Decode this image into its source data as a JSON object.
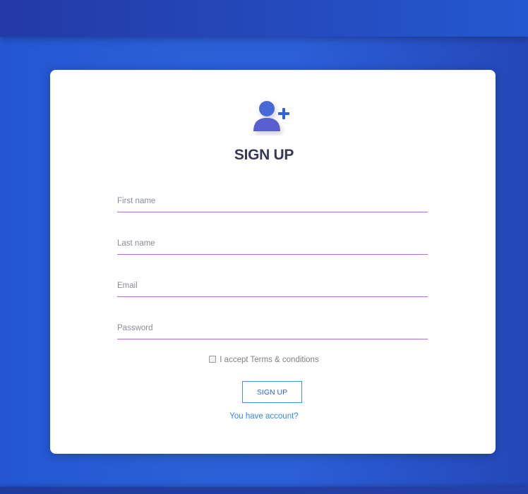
{
  "form": {
    "title": "SIGN UP",
    "icon": "add-user-icon",
    "fields": {
      "first_name": {
        "placeholder": "First name",
        "value": ""
      },
      "last_name": {
        "placeholder": "Last name",
        "value": ""
      },
      "email": {
        "placeholder": "Email",
        "value": ""
      },
      "password": {
        "placeholder": "Password",
        "value": ""
      }
    },
    "terms_label": "I accept Terms & conditions",
    "terms_checked": false,
    "submit_label": "SIGN UP",
    "account_link": "You have account?"
  },
  "colors": {
    "accent": "#2b5fd8",
    "field_underline": "#b16fe0",
    "title": "#343a55",
    "link": "#3a84f0",
    "icon_person": "#5a64d6",
    "icon_plus": "#2f63d6"
  }
}
